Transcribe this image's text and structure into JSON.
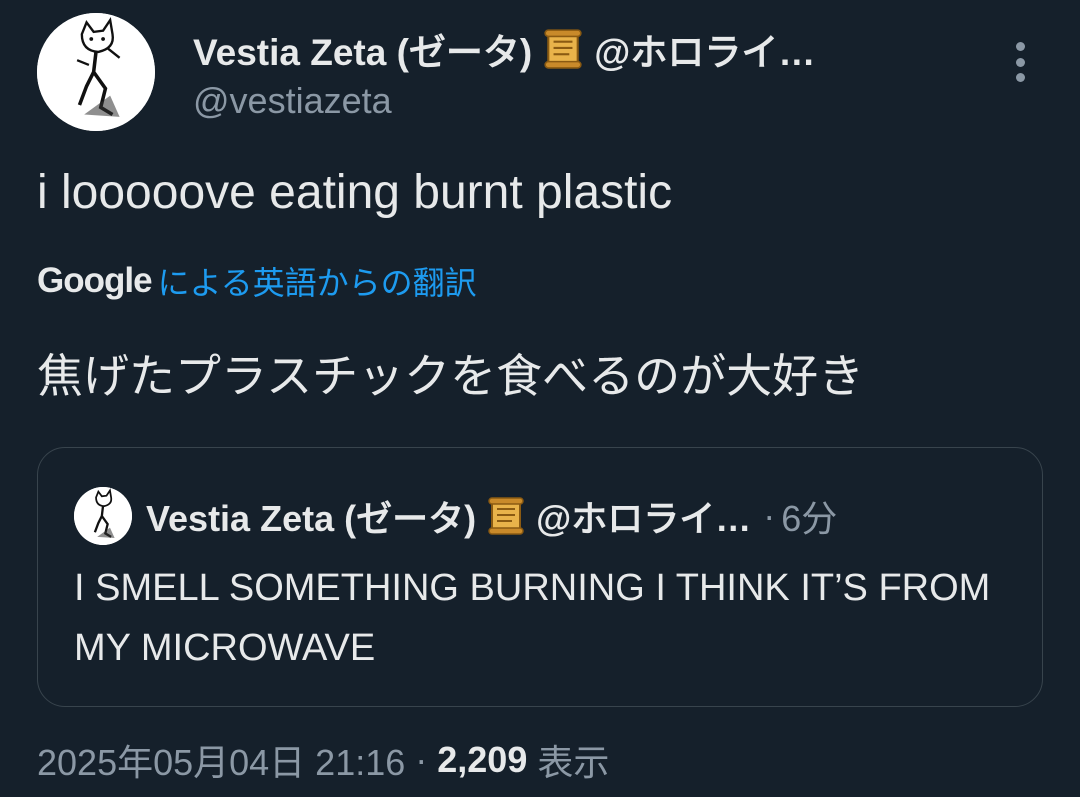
{
  "author": {
    "display_name": "Vestia Zeta (ゼータ)",
    "affiliation": "@ホロライ…",
    "handle": "@vestiazeta"
  },
  "tweet": {
    "text": "i looooove eating burnt plastic",
    "translation_provider": "Google",
    "translation_label": "による英語からの翻訳",
    "translated_text": "焦げたプラスチックを食べるのが大好き"
  },
  "quoted_tweet": {
    "display_name": "Vestia Zeta (ゼータ)",
    "affiliation": "@ホロライ…",
    "separator": "·",
    "time_ago": "6分",
    "text": "I SMELL SOMETHING BURNING I THINK IT’S FROM MY MICROWAVE"
  },
  "meta": {
    "timestamp": "2025年05月04日 21:16",
    "separator": "·",
    "views_count": "2,209",
    "views_label": "表示"
  },
  "icons": {
    "more": "more-vertical-icon",
    "scroll": "scroll-emoji-icon"
  },
  "colors": {
    "background": "#15202b",
    "link": "#1d9bf0",
    "secondary_text": "#8b98a5"
  }
}
